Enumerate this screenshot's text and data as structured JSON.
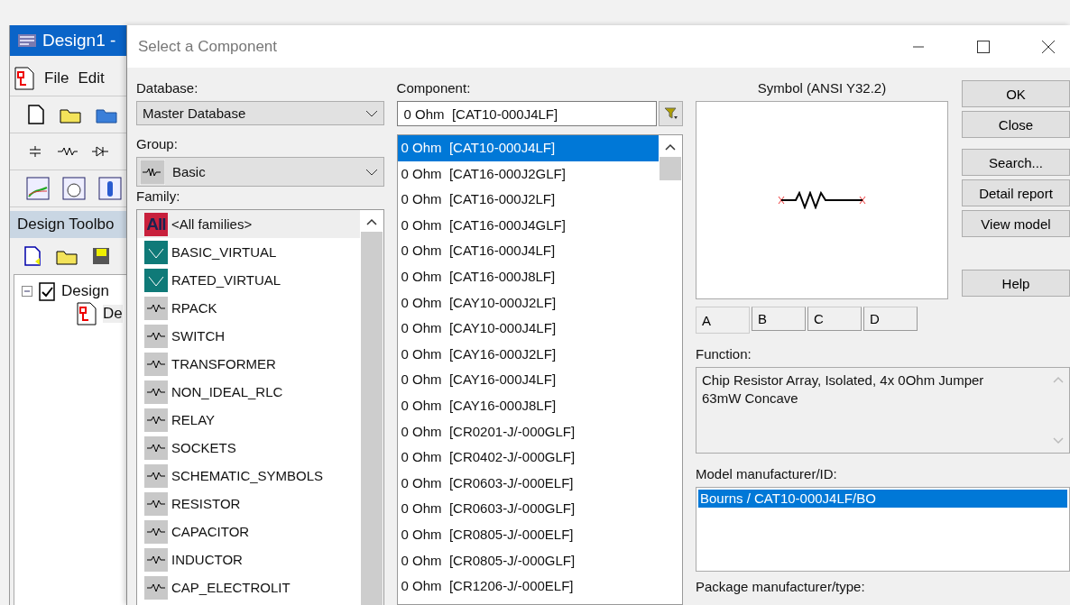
{
  "app_window": {
    "title": "Design1 -",
    "menu": [
      "File",
      "Edit"
    ],
    "panel_title": "Design Toolbo",
    "tree": [
      {
        "label": "Design",
        "children": [
          {
            "label": "De",
            "selected": true
          }
        ]
      }
    ]
  },
  "dialog": {
    "title": "Select a Component",
    "database": {
      "label": "Database:",
      "value": "Master Database"
    },
    "group": {
      "label": "Group:",
      "value": "Basic"
    },
    "family": {
      "label": "Family:",
      "items": [
        {
          "label": "<All families>",
          "kind": "all",
          "icon_text": "All",
          "selected": true
        },
        {
          "label": "BASIC_VIRTUAL",
          "kind": "virtual",
          "selected": false
        },
        {
          "label": "RATED_VIRTUAL",
          "kind": "virtual",
          "selected": false
        },
        {
          "label": "RPACK",
          "kind": "normal",
          "selected": false
        },
        {
          "label": "SWITCH",
          "kind": "normal",
          "selected": false
        },
        {
          "label": "TRANSFORMER",
          "kind": "normal",
          "selected": false
        },
        {
          "label": "NON_IDEAL_RLC",
          "kind": "normal",
          "selected": false
        },
        {
          "label": "RELAY",
          "kind": "normal",
          "selected": false
        },
        {
          "label": "SOCKETS",
          "kind": "normal",
          "selected": false
        },
        {
          "label": "SCHEMATIC_SYMBOLS",
          "kind": "normal",
          "selected": false
        },
        {
          "label": "RESISTOR",
          "kind": "normal",
          "selected": false
        },
        {
          "label": "CAPACITOR",
          "kind": "normal",
          "selected": false
        },
        {
          "label": "INDUCTOR",
          "kind": "normal",
          "selected": false
        },
        {
          "label": "CAP_ELECTROLIT",
          "kind": "normal",
          "selected": false
        }
      ]
    },
    "component": {
      "label": "Component:",
      "value": "0 Ohm  [CAT10-000J4LF]",
      "items": [
        {
          "label": "0 Ohm  [CAT10-000J4LF]",
          "selected": true
        },
        {
          "label": "0 Ohm  [CAT16-000J2GLF]",
          "selected": false
        },
        {
          "label": "0 Ohm  [CAT16-000J2LF]",
          "selected": false
        },
        {
          "label": "0 Ohm  [CAT16-000J4GLF]",
          "selected": false
        },
        {
          "label": "0 Ohm  [CAT16-000J4LF]",
          "selected": false
        },
        {
          "label": "0 Ohm  [CAT16-000J8LF]",
          "selected": false
        },
        {
          "label": "0 Ohm  [CAY10-000J2LF]",
          "selected": false
        },
        {
          "label": "0 Ohm  [CAY10-000J4LF]",
          "selected": false
        },
        {
          "label": "0 Ohm  [CAY16-000J2LF]",
          "selected": false
        },
        {
          "label": "0 Ohm  [CAY16-000J4LF]",
          "selected": false
        },
        {
          "label": "0 Ohm  [CAY16-000J8LF]",
          "selected": false
        },
        {
          "label": "0 Ohm  [CR0201-J/-000GLF]",
          "selected": false
        },
        {
          "label": "0 Ohm  [CR0402-J/-000GLF]",
          "selected": false
        },
        {
          "label": "0 Ohm  [CR0603-J/-000ELF]",
          "selected": false
        },
        {
          "label": "0 Ohm  [CR0603-J/-000GLF]",
          "selected": false
        },
        {
          "label": "0 Ohm  [CR0805-J/-000ELF]",
          "selected": false
        },
        {
          "label": "0 Ohm  [CR0805-J/-000GLF]",
          "selected": false
        },
        {
          "label": "0 Ohm  [CR1206-J/-000ELF]",
          "selected": false
        }
      ]
    },
    "symbol": {
      "label": "Symbol (ANSI Y32.2)",
      "tabs": [
        {
          "label": "A",
          "selected": true
        },
        {
          "label": "B",
          "selected": false
        },
        {
          "label": "C",
          "selected": false
        },
        {
          "label": "D",
          "selected": false
        }
      ]
    },
    "buttons": [
      {
        "label": "OK"
      },
      {
        "label": "Close"
      },
      {
        "label": "Search..."
      },
      {
        "label": "Detail report"
      },
      {
        "label": "View model"
      },
      {
        "label": "Help"
      }
    ],
    "function": {
      "label": "Function:",
      "text": "Chip Resistor Array, Isolated, 4x 0Ohm Jumper\n63mW Concave"
    },
    "model": {
      "label": "Model manufacturer/ID:",
      "items": [
        {
          "label": "Bourns / CAT10-000J4LF/BO",
          "selected": true
        }
      ]
    },
    "package": {
      "label": "Package manufacturer/type:"
    }
  }
}
